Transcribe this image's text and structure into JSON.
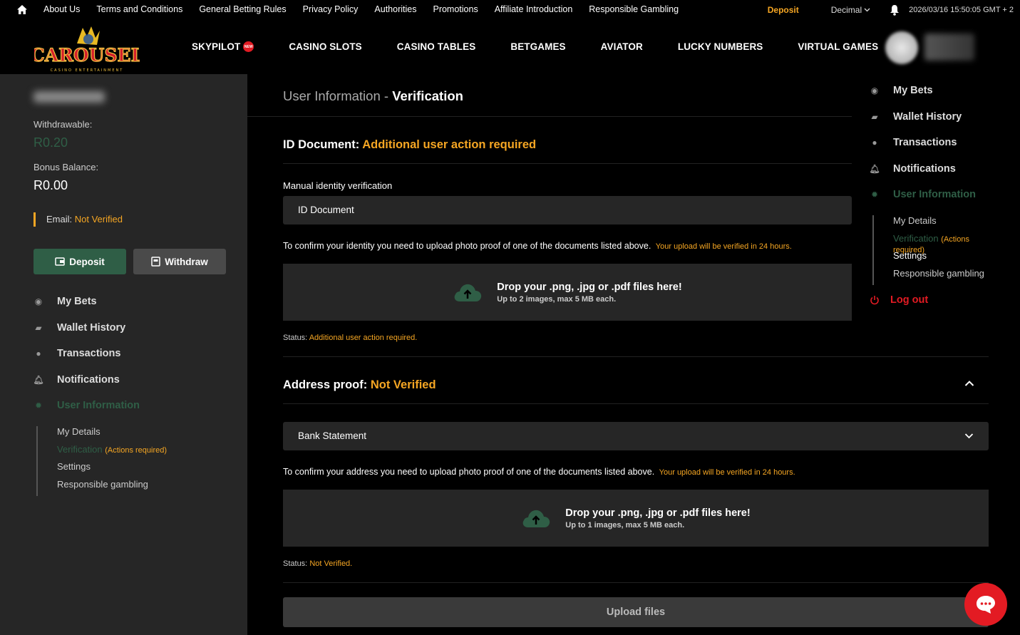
{
  "topbar": {
    "links": [
      "About Us",
      "Terms and Conditions",
      "General Betting Rules",
      "Privacy Policy",
      "Authorities",
      "Promotions",
      "Affiliate Introduction",
      "Responsible Gambling"
    ],
    "deposit": "Deposit",
    "odds_format": "Decimal",
    "datetime": "2026/03/16 15:50:05 GMT + 2"
  },
  "brand": {
    "logo_text": "CAROUSEL",
    "logo_sub": "CASINO ENTERTAINMENT"
  },
  "nav": {
    "items": [
      "SKYPILOT",
      "CASINO SLOTS",
      "CASINO TABLES",
      "BETGAMES",
      "AVIATOR",
      "LUCKY NUMBERS",
      "VIRTUAL GAMES"
    ],
    "new_badge": "NEW"
  },
  "sidebar": {
    "withdrawable_label": "Withdrawable:",
    "withdrawable_value": "R0.20",
    "bonus_label": "Bonus Balance:",
    "bonus_value": "R0.00",
    "email_label": "Email:",
    "email_status": "Not Verified",
    "deposit_btn": "Deposit",
    "withdraw_btn": "Withdraw"
  },
  "menu": {
    "my_bets": "My Bets",
    "wallet_history": "Wallet History",
    "transactions": "Transactions",
    "notifications": "Notifications",
    "user_information": "User Information",
    "sub": {
      "my_details": "My Details",
      "verification": "Verification",
      "actions_required": "(Actions required)",
      "settings": "Settings",
      "responsible_gambling": "Responsible gambling"
    },
    "logout": "Log out"
  },
  "page": {
    "title_prefix": "User Information",
    "title_sep": " - ",
    "title_main": "Verification"
  },
  "id_section": {
    "head": "ID Document:",
    "status_head": "Additional user action required",
    "label": "Manual identity verification",
    "select_value": "ID Document",
    "confirm": "To confirm your identity you need to upload photo proof of one of the documents listed above.",
    "confirm_note": "Your upload will be verified in 24 hours.",
    "drop_title": "Drop your .png, .jpg or .pdf files here!",
    "drop_sub": "Up to 2 images, max 5 MB each.",
    "status_label": "Status:",
    "status_value": "Additional user action required."
  },
  "address_section": {
    "head": "Address proof:",
    "status_head": "Not Verified",
    "select_value": "Bank Statement",
    "confirm": "To confirm your address you need to upload photo proof of one of the documents listed above.",
    "confirm_note": "Your upload will be verified in 24 hours.",
    "drop_title": "Drop your .png, .jpg or .pdf files here!",
    "drop_sub": "Up to 1 images, max 5 MB each.",
    "status_label": "Status:",
    "status_value": "Not Verified."
  },
  "upload_btn": "Upload files",
  "colors": {
    "accent": "#f5a623",
    "green": "#2f5e46",
    "red": "#e31b23",
    "panel": "#262626"
  }
}
